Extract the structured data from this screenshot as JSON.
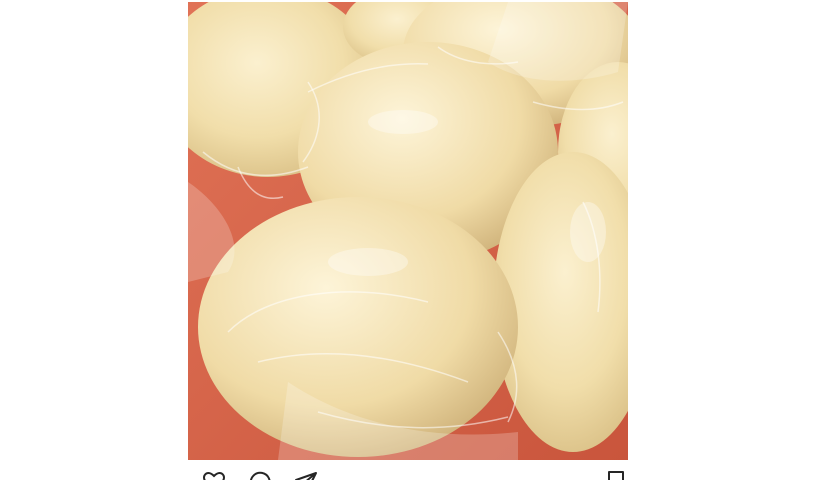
{
  "post": {
    "image": {
      "subject": "cheese-rounds-photo",
      "colors": {
        "background": "#d9644a",
        "cheese": "#f3e2b4",
        "cheese_shadow": "#d8c08a",
        "wrap": "#ffffff"
      }
    },
    "actions": {
      "like_icon": "heart-icon",
      "comment_icon": "comment-icon",
      "share_icon": "share-icon",
      "save_icon": "bookmark-icon"
    }
  }
}
